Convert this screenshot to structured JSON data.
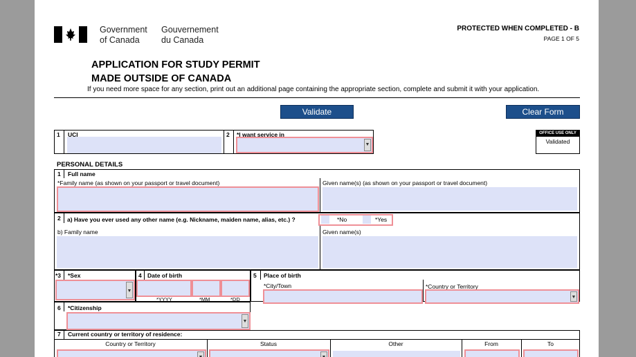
{
  "header": {
    "gov_en_line1": "Government",
    "gov_en_line2": "of Canada",
    "gov_fr_line1": "Gouvernement",
    "gov_fr_line2": "du Canada",
    "protected": "PROTECTED WHEN COMPLETED - B",
    "page": "PAGE 1 OF 5"
  },
  "title": {
    "line1": "APPLICATION FOR STUDY PERMIT",
    "line2": "MADE OUTSIDE OF CANADA",
    "note": "If you need more space for any section, print out an additional page containing the appropriate section, complete and submit it with your application."
  },
  "buttons": {
    "validate": "Validate",
    "clear": "Clear Form"
  },
  "top_section": {
    "n1": "1",
    "uci": "UCI",
    "n2": "2",
    "service": "*I want service in"
  },
  "office": {
    "title": "OFFICE USE ONLY",
    "status": "Validated"
  },
  "personal": {
    "heading": "PERSONAL DETAILS",
    "n1": "1",
    "full_name": "Full name",
    "family_label": "*Family name  (as shown on your passport or travel document)",
    "given_label": "Given name(s)  (as shown on your passport or travel document)",
    "n2": "2",
    "other_name_q": "a)  Have you ever used any other name (e.g. Nickname, maiden name, alias, etc.) ?",
    "no": "*No",
    "yes": "*Yes",
    "b_family": "b) Family name",
    "b_given": "Given name(s)",
    "n3": "*3",
    "sex": "*Sex",
    "n4": "4",
    "dob": "Date of birth",
    "yyyy": "*YYYY",
    "mm": "*MM",
    "dd": "*DD",
    "n5": "5",
    "pob": "Place of birth",
    "city": "*City/Town",
    "country": "*Country or Territory",
    "n6": "6",
    "citizenship": "*Citizenship",
    "n7": "7",
    "residence": "Current country or territory of residence:",
    "cols": [
      "Country or Territory",
      "Status",
      "Other",
      "From",
      "To"
    ]
  }
}
